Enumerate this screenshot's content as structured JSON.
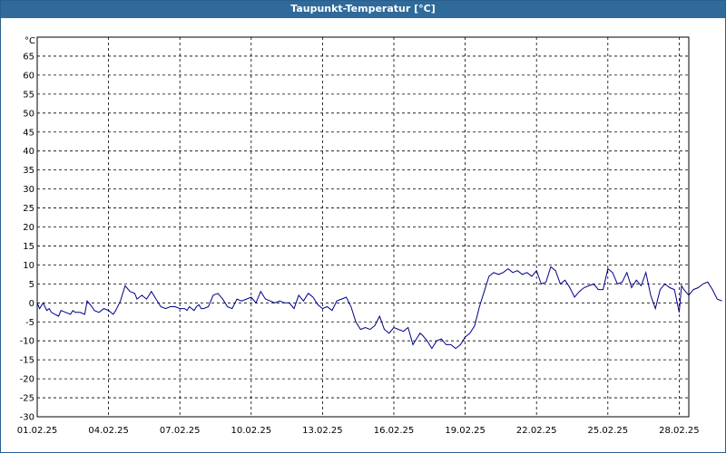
{
  "window": {
    "title": "Taupunkt-Temperatur [°C]"
  },
  "chart_data": {
    "type": "line",
    "title": "Taupunkt-Temperatur [°C]",
    "y_unit_label": "°C",
    "ylim": [
      -30,
      70
    ],
    "y_ticks": [
      65,
      60,
      55,
      50,
      45,
      40,
      35,
      30,
      25,
      20,
      15,
      10,
      5,
      0,
      -5,
      -10,
      -15,
      -20,
      -25,
      -30
    ],
    "x_range": [
      "01.02.25",
      "01.03.25 (approx.)"
    ],
    "x_ticks": [
      "01.02.25",
      "04.02.25",
      "07.02.25",
      "10.02.25",
      "13.02.25",
      "16.02.25",
      "19.02.25",
      "22.02.25",
      "25.02.25",
      "28.02.25"
    ],
    "grid": true,
    "line_color": "#00008b",
    "series": [
      {
        "x_days_from_start": [
          0.0,
          0.1,
          0.25,
          0.4,
          0.5,
          0.6,
          0.75,
          0.9,
          1.0,
          1.2,
          1.4,
          1.5,
          1.6,
          1.8,
          2.0,
          2.1,
          2.3,
          2.4,
          2.6,
          2.8,
          3.0,
          3.2,
          3.3,
          3.5,
          3.7,
          3.9,
          4.1,
          4.2,
          4.4,
          4.6,
          4.8,
          5.0,
          5.2,
          5.4,
          5.6,
          5.8,
          6.0,
          6.2,
          6.3,
          6.4,
          6.5,
          6.6,
          6.7,
          6.8,
          6.9,
          7.0,
          7.2,
          7.4,
          7.6,
          7.8,
          8.0,
          8.2,
          8.4,
          8.6,
          8.8,
          9.0,
          9.2,
          9.4,
          9.6,
          9.8,
          10.0,
          10.2,
          10.4,
          10.6,
          10.8,
          11.0,
          11.2,
          11.4,
          11.6,
          11.8,
          12.0,
          12.2,
          12.4,
          12.6,
          12.8,
          13.0,
          13.2,
          13.4,
          13.6,
          13.8,
          14.0,
          14.2,
          14.4,
          14.6,
          14.8,
          15.0,
          15.2,
          15.4,
          15.6,
          15.8,
          16.0,
          16.1,
          16.2,
          16.4,
          16.6,
          16.8,
          17.0,
          17.2,
          17.4,
          17.6,
          17.8,
          18.0,
          18.2,
          18.4,
          18.6,
          18.8,
          19.0,
          19.2,
          19.4,
          19.6,
          19.8,
          20.0,
          20.2,
          20.4,
          20.6,
          20.8,
          21.0,
          21.2,
          21.4,
          21.6,
          21.8,
          22.0,
          22.2,
          22.4,
          22.6,
          22.8,
          23.0,
          23.2,
          23.4,
          23.6,
          23.8,
          24.0,
          24.2,
          24.4,
          24.6,
          24.8,
          25.0,
          25.2,
          25.4,
          25.6,
          25.8,
          26.0,
          26.1,
          26.2,
          26.4,
          26.6,
          26.8,
          27.0,
          27.1,
          27.2,
          27.4,
          27.6,
          27.8,
          28.0,
          28.2,
          28.4,
          28.6,
          28.8,
          28.9
        ],
        "values": [
          0,
          -1.5,
          0,
          -2.0,
          -1.5,
          -2.5,
          -3.0,
          -3.5,
          -2.0,
          -2.5,
          -3.0,
          -2.0,
          -2.5,
          -2.5,
          -3.0,
          0.5,
          -1.0,
          -2.0,
          -2.5,
          -1.5,
          -2.0,
          -3.0,
          -2.0,
          0.5,
          4.5,
          3.0,
          2.5,
          1.0,
          2.0,
          1.0,
          3.0,
          1.0,
          -1.0,
          -1.5,
          -1.0,
          -1.0,
          -1.5,
          -1.5,
          -2.0,
          -1.0,
          -1.5,
          -2.0,
          -1.0,
          -0.5,
          -1.5,
          -1.5,
          -1.0,
          2.0,
          2.5,
          1.0,
          -1.0,
          -1.5,
          1.0,
          0.5,
          1.0,
          1.5,
          0.0,
          3.0,
          1.0,
          0.5,
          0.0,
          0.5,
          0.0,
          0.0,
          -1.5,
          2.0,
          0.5,
          2.5,
          1.5,
          -0.5,
          -1.5,
          -1.0,
          -2.0,
          0.5,
          1.0,
          1.5,
          -1.0,
          -5.0,
          -7.0,
          -6.5,
          -7.0,
          -6.0,
          -3.5,
          -7.0,
          -8.0,
          -6.5,
          -7.0,
          -7.5,
          -6.5,
          -11.0,
          -9.0,
          -8.0,
          -8.5,
          -10.0,
          -12.0,
          -10.0,
          -9.5,
          -11.0,
          -11.0,
          -12.0,
          -11.0,
          -9.0,
          -8.0,
          -6.0,
          -1.0,
          3.0,
          7.0,
          8.0,
          7.5,
          8.0,
          9.0,
          8.0,
          8.5,
          7.5,
          8.0,
          7.0,
          8.5,
          5.0,
          5.5,
          9.5,
          8.5,
          5.0,
          6.0,
          4.0,
          1.5,
          3.0,
          4.0,
          4.5,
          5.0,
          3.5,
          3.5,
          9.0,
          8.0,
          5.0,
          5.5,
          8.0,
          4.0,
          6.0,
          4.5,
          8.0,
          2.0,
          -1.5,
          1.0,
          3.5,
          5.0,
          4.0,
          3.5,
          -2.5,
          4.5,
          3.5,
          2.0,
          3.5,
          4.0,
          5.0,
          5.5,
          3.5,
          1.0,
          0.5
        ]
      }
    ]
  }
}
